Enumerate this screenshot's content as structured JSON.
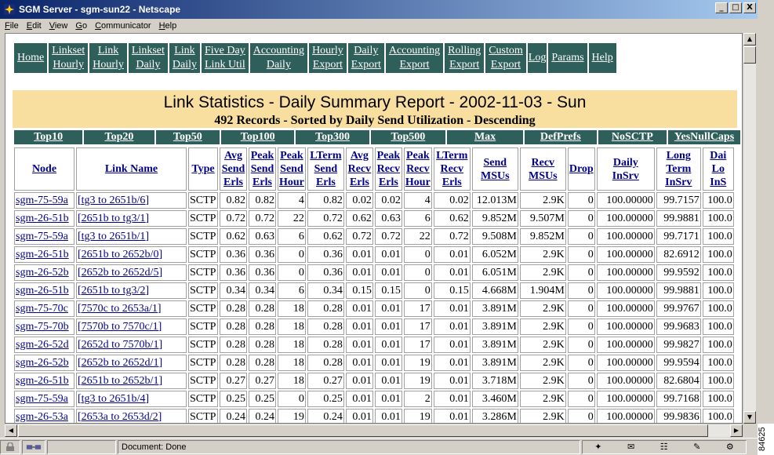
{
  "window": {
    "title": "SGM Server - sgm-sun22 - Netscape",
    "controls": [
      "_",
      "□",
      "X"
    ]
  },
  "menu": [
    "File",
    "Edit",
    "View",
    "Go",
    "Communicator",
    "Help"
  ],
  "nav": [
    "Home",
    "Linkset\nHourly",
    "Link\nHourly",
    "Linkset\nDaily",
    "Link\nDaily",
    "Five Day\nLink Util",
    "Accounting\nDaily",
    "Hourly\nExport",
    "Daily\nExport",
    "Accounting\nExport",
    "Rolling\nExport",
    "Custom\nExport",
    "Log",
    "Params",
    "Help"
  ],
  "report": {
    "title": "Link Statistics - Daily Summary Report - 2002-11-03 - Sun",
    "subtitle": "492 Records - Sorted by Daily Send Utilization - Descending"
  },
  "sort_links": [
    "Top10",
    "Top20",
    "Top50",
    "Top100",
    "Top300",
    "Top500",
    "Max",
    "DefPrefs",
    "NoSCTP",
    "YesNullCaps"
  ],
  "table": {
    "headers": [
      "Node",
      "Link Name",
      "Type",
      "Avg\nSend\nErls",
      "Peak\nSend\nErls",
      "Peak\nSend\nHour",
      "LTerm\nSend\nErls",
      "Avg\nRecv\nErls",
      "Peak\nRecv\nErls",
      "Peak\nRecv\nHour",
      "LTerm\nRecv\nErls",
      "Send\nMSUs",
      "Recv\nMSUs",
      "Drop",
      "Daily\nInSrv",
      "Long\nTerm\nInSrv",
      "Dai\nLo\nInS"
    ],
    "rows": [
      [
        "sgm-75-59a",
        "[tg3  to  2651b/6]",
        "SCTP",
        "0.82",
        "0.82",
        "4",
        "0.82",
        "0.02",
        "0.02",
        "4",
        "0.02",
        "12.013M",
        "2.9K",
        "0",
        "100.00000",
        "99.7157",
        "100.0"
      ],
      [
        "sgm-26-51b",
        "[2651b  to  tg3/1]",
        "SCTP",
        "0.72",
        "0.72",
        "22",
        "0.72",
        "0.62",
        "0.63",
        "6",
        "0.62",
        "9.852M",
        "9.507M",
        "0",
        "100.00000",
        "99.9881",
        "100.0"
      ],
      [
        "sgm-75-59a",
        "[tg3  to  2651b/1]",
        "SCTP",
        "0.62",
        "0.63",
        "6",
        "0.62",
        "0.72",
        "0.72",
        "22",
        "0.72",
        "9.508M",
        "9.852M",
        "0",
        "100.00000",
        "99.7171",
        "100.0"
      ],
      [
        "sgm-26-51b",
        "[2651b  to  2652b/0]",
        "SCTP",
        "0.36",
        "0.36",
        "0",
        "0.36",
        "0.01",
        "0.01",
        "0",
        "0.01",
        "6.052M",
        "2.9K",
        "0",
        "100.00000",
        "82.6912",
        "100.0"
      ],
      [
        "sgm-26-52b",
        "[2652b  to  2652d/5]",
        "SCTP",
        "0.36",
        "0.36",
        "0",
        "0.36",
        "0.01",
        "0.01",
        "0",
        "0.01",
        "6.051M",
        "2.9K",
        "0",
        "100.00000",
        "99.9592",
        "100.0"
      ],
      [
        "sgm-26-51b",
        "[2651b  to  tg3/2]",
        "SCTP",
        "0.34",
        "0.34",
        "6",
        "0.34",
        "0.15",
        "0.15",
        "0",
        "0.15",
        "4.668M",
        "1.904M",
        "0",
        "100.00000",
        "99.9881",
        "100.0"
      ],
      [
        "sgm-75-70c",
        "[7570c  to  2653a/1]",
        "SCTP",
        "0.28",
        "0.28",
        "18",
        "0.28",
        "0.01",
        "0.01",
        "17",
        "0.01",
        "3.891M",
        "2.9K",
        "0",
        "100.00000",
        "99.9767",
        "100.0"
      ],
      [
        "sgm-75-70b",
        "[7570b  to  7570c/1]",
        "SCTP",
        "0.28",
        "0.28",
        "18",
        "0.28",
        "0.01",
        "0.01",
        "17",
        "0.01",
        "3.891M",
        "2.9K",
        "0",
        "100.00000",
        "99.9683",
        "100.0"
      ],
      [
        "sgm-26-52d",
        "[2652d  to  7570b/1]",
        "SCTP",
        "0.28",
        "0.28",
        "18",
        "0.28",
        "0.01",
        "0.01",
        "17",
        "0.01",
        "3.891M",
        "2.9K",
        "0",
        "100.00000",
        "99.9827",
        "100.0"
      ],
      [
        "sgm-26-52b",
        "[2652b  to  2652d/1]",
        "SCTP",
        "0.28",
        "0.28",
        "18",
        "0.28",
        "0.01",
        "0.01",
        "19",
        "0.01",
        "3.891M",
        "2.9K",
        "0",
        "100.00000",
        "99.9594",
        "100.0"
      ],
      [
        "sgm-26-51b",
        "[2651b  to  2652b/1]",
        "SCTP",
        "0.27",
        "0.27",
        "18",
        "0.27",
        "0.01",
        "0.01",
        "19",
        "0.01",
        "3.718M",
        "2.9K",
        "0",
        "100.00000",
        "82.6804",
        "100.0"
      ],
      [
        "sgm-75-59a",
        "[tg3  to  2651b/4]",
        "SCTP",
        "0.25",
        "0.25",
        "0",
        "0.25",
        "0.01",
        "0.01",
        "2",
        "0.01",
        "3.460M",
        "2.9K",
        "0",
        "100.00000",
        "99.7168",
        "100.0"
      ],
      [
        "sgm-26-53a",
        "[2653a  to  2653d/2]",
        "SCTP",
        "0.24",
        "0.24",
        "19",
        "0.24",
        "0.01",
        "0.01",
        "19",
        "0.01",
        "3.286M",
        "2.9K",
        "0",
        "100.00000",
        "99.9836",
        "100.0"
      ]
    ]
  },
  "status": {
    "text": "Document: Done",
    "side_label": "84625"
  }
}
